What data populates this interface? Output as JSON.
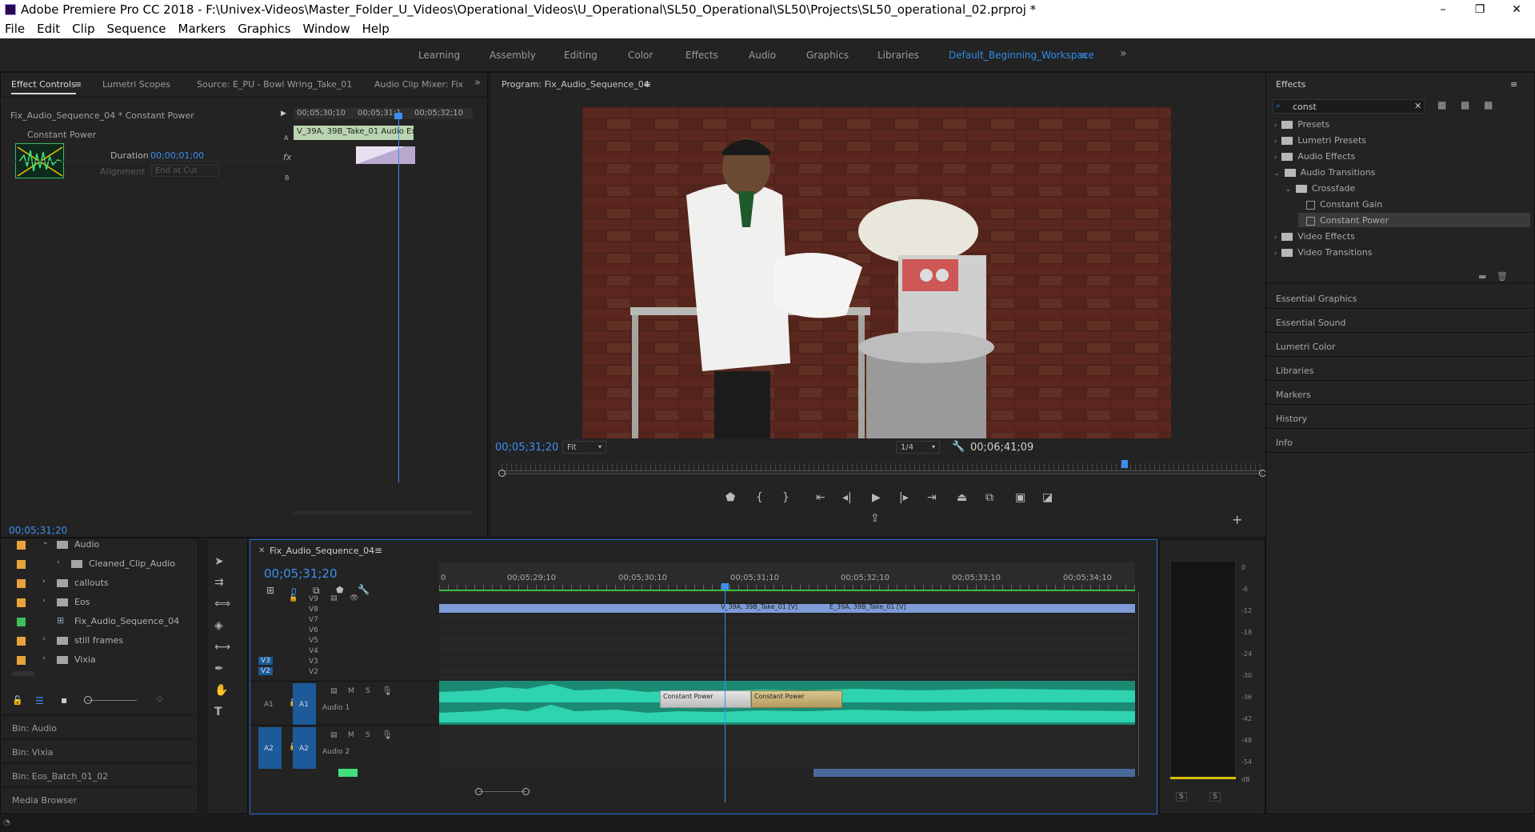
{
  "window": {
    "title": "Adobe Premiere Pro CC 2018 - F:\\Univex-Videos\\Master_Folder_U_Videos\\Operational_Videos\\U_Operational\\SL50_Operational\\SL50\\Projects\\SL50_operational_02.prproj *",
    "minimize": "–",
    "maximize": "❐",
    "close": "✕"
  },
  "menu": [
    "File",
    "Edit",
    "Clip",
    "Sequence",
    "Markers",
    "Graphics",
    "Window",
    "Help"
  ],
  "workspaces": {
    "items": [
      "Learning",
      "Assembly",
      "Editing",
      "Color",
      "Effects",
      "Audio",
      "Graphics",
      "Libraries",
      "Default_Beginning_Workspace"
    ],
    "active": "Default_Beginning_Workspace",
    "more": "»"
  },
  "source_panel": {
    "tabs": [
      "Effect Controls",
      "Lumetri Scopes",
      "Source: E_PU - Bowl Wring_Take_01",
      "Audio Clip Mixer: Fix"
    ],
    "clip_path": "Fix_Audio_Sequence_04 * Constant Power",
    "effect_name": "Constant Power",
    "duration_label": "Duration",
    "duration_value": "00;00;01;00",
    "alignment_label": "Alignment",
    "alignment_value": "End at Cut",
    "mini_times": [
      "00;05;30;10",
      "00;05;31;1",
      "00;05;32;10"
    ],
    "mini_clip": "V_39A, 39B_Take_01 Audio Ex",
    "track_a": "A",
    "track_b": "B",
    "fx": "fx",
    "timecode": "00;05;31;20"
  },
  "program": {
    "title": "Program: Fix_Audio_Sequence_04",
    "timecode": "00;05;31;20",
    "fit": "Fit",
    "resolution": "1/4",
    "duration": "00;06;41;09"
  },
  "effects_panel": {
    "title": "Effects",
    "search_value": "const",
    "tree": [
      {
        "label": "Presets",
        "depth": 0,
        "type": "folder"
      },
      {
        "label": "Lumetri Presets",
        "depth": 0,
        "type": "folder"
      },
      {
        "label": "Audio Effects",
        "depth": 0,
        "type": "folder"
      },
      {
        "label": "Audio Transitions",
        "depth": 0,
        "type": "folder",
        "open": true
      },
      {
        "label": "Crossfade",
        "depth": 1,
        "type": "folder",
        "open": true
      },
      {
        "label": "Constant Gain",
        "depth": 2,
        "type": "effect"
      },
      {
        "label": "Constant Power",
        "depth": 2,
        "type": "effect",
        "selected": true
      },
      {
        "label": "Video Effects",
        "depth": 0,
        "type": "folder"
      },
      {
        "label": "Video Transitions",
        "depth": 0,
        "type": "folder"
      }
    ],
    "side_panels": [
      "Essential Graphics",
      "Essential Sound",
      "Lumetri Color",
      "Libraries",
      "Markers",
      "History",
      "Info"
    ]
  },
  "project": {
    "items": [
      {
        "label": "Audio",
        "color": "#e8a33c",
        "kind": "folder",
        "indent": 1
      },
      {
        "label": "Cleaned_Clip_Audio",
        "color": "#e8a33c",
        "kind": "folder",
        "indent": 2
      },
      {
        "label": "callouts",
        "color": "#e8a33c",
        "kind": "folder",
        "indent": 1
      },
      {
        "label": "Eos",
        "color": "#e8a33c",
        "kind": "folder",
        "indent": 1
      },
      {
        "label": "Fix_Audio_Sequence_04",
        "color": "#3fbf5a",
        "kind": "sequence",
        "indent": 1
      },
      {
        "label": "still frames",
        "color": "#e8a33c",
        "kind": "folder",
        "indent": 1
      },
      {
        "label": "Vixia",
        "color": "#e8a33c",
        "kind": "folder",
        "indent": 1
      }
    ],
    "bins": [
      "Bin: Audio",
      "Bin: Vixia",
      "Bin: Eos_Batch_01_02",
      "Media Browser"
    ]
  },
  "timeline": {
    "sequence_name": "Fix_Audio_Sequence_04",
    "timecode": "00;05;31;20",
    "ruler": [
      "0",
      "00;05;29;10",
      "00;05;30;10",
      "00;05;31;10",
      "00;05;32;10",
      "00;05;33;10",
      "00;05;34;10"
    ],
    "video_tracks": [
      "V9",
      "V8",
      "V7",
      "V6",
      "V5",
      "V4",
      "V3",
      "V2"
    ],
    "patched": [
      "V3",
      "V2"
    ],
    "video_clips": [
      "V_39A, 39B_Take_01 [V]",
      "E_39A, 39B_Take_01 [V]"
    ],
    "audio_tracks": [
      {
        "id": "A1",
        "name": "Audio 1"
      },
      {
        "id": "A2",
        "name": "Audio 2"
      }
    ],
    "track_buttons": {
      "mute": "M",
      "solo": "S"
    },
    "transitions": [
      "Constant Power",
      "Constant Power"
    ]
  },
  "meter": {
    "scale": [
      "0",
      "-6",
      "-12",
      "-18",
      "-24",
      "-30",
      "-36",
      "-42",
      "-48",
      "-54",
      "dB"
    ],
    "solo": [
      "S",
      "S"
    ]
  },
  "colors": {
    "accent": "#2d8ceb",
    "clip_audio": "#1f9e84",
    "clip_video": "#7d9bd6",
    "transition_1": "#cfcfcf",
    "transition_2": "#c8b27a"
  }
}
